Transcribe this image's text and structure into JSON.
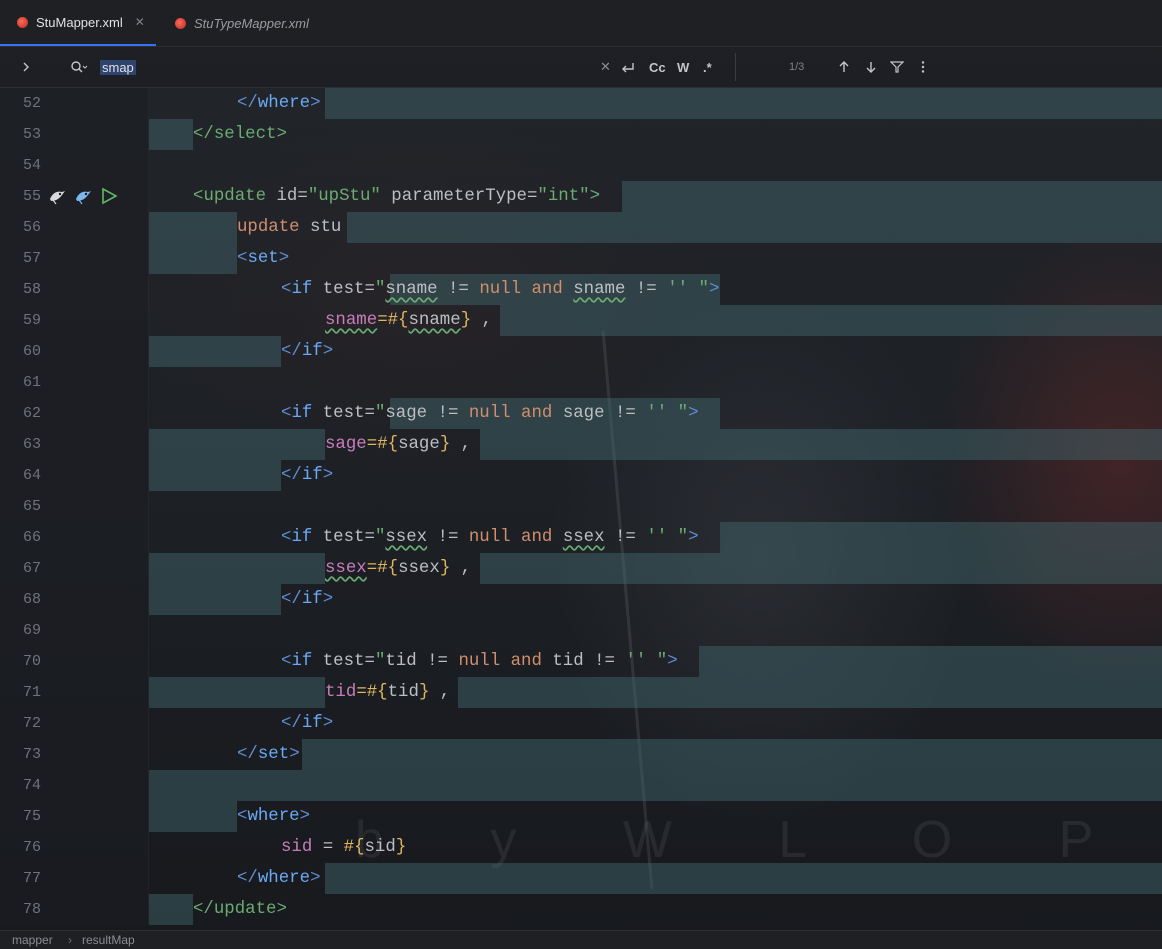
{
  "tabs": [
    {
      "label": "StuMapper.xml",
      "active": true,
      "close_icon": "close-icon"
    },
    {
      "label": "StuTypeMapper.xml",
      "active": false
    }
  ],
  "search": {
    "query": "smap",
    "options": [
      "Cc",
      "W",
      ".*"
    ],
    "match_count": "1/3"
  },
  "lines": [
    "52",
    "53",
    "54",
    "55",
    "56",
    "57",
    "58",
    "59",
    "60",
    "61",
    "62",
    "63",
    "64",
    "65",
    "66",
    "67",
    "68",
    "69",
    "70",
    "71",
    "72",
    "73",
    "74",
    "75",
    "76",
    "77",
    "78"
  ],
  "code": {
    "l52": {
      "open": "</",
      "tag": "where",
      "close": ">"
    },
    "l53": {
      "open": "</",
      "tag": "select",
      "close": ">"
    },
    "l55": {
      "open": "<",
      "tag": "update",
      "attr1": " id=",
      "val1": "\"upStu\"",
      "attr2": " parameterType=",
      "val2": "\"int\"",
      "close": ">"
    },
    "l56": {
      "kw": "update",
      "rest": " stu"
    },
    "l57": {
      "open": "<",
      "tag": "set",
      "close": ">"
    },
    "l58": {
      "open": "<",
      "tag": "if",
      "attr": " test=",
      "q": "\"",
      "v1": "sname",
      "op1": " != ",
      "nul": "null",
      "and": " and ",
      "v2": "sname",
      "op2": " != ",
      "e": "''",
      "q2": " \"",
      "close": ">"
    },
    "l59": {
      "prop": "sname",
      "eq": "=#{",
      "v": "sname",
      "rb": "}",
      "comma": " ,"
    },
    "l60": {
      "open": "</",
      "tag": "if",
      "close": ">"
    },
    "l62": {
      "open": "<",
      "tag": "if",
      "attr": " test=",
      "q": "\"",
      "v1": "sage",
      "op1": " != ",
      "nul": "null",
      "and": " and ",
      "v2": "sage",
      "op2": " != ",
      "e": "''",
      "q2": " \"",
      "close": ">"
    },
    "l63": {
      "prop": "sage",
      "eq": "=#{",
      "v": "sage",
      "rb": "}",
      "comma": " ,"
    },
    "l64": {
      "open": "</",
      "tag": "if",
      "close": ">"
    },
    "l66": {
      "open": "<",
      "tag": "if",
      "attr": " test=",
      "q": "\"",
      "v1": "ssex",
      "op1": " != ",
      "nul": "null",
      "and": " and ",
      "v2": "ssex",
      "op2": " != ",
      "e": "''",
      "q2": " \"",
      "close": ">"
    },
    "l67": {
      "prop": "ssex",
      "eq": "=#{",
      "v": "ssex",
      "rb": "}",
      "comma": " ,"
    },
    "l68": {
      "open": "</",
      "tag": "if",
      "close": ">"
    },
    "l70": {
      "open": "<",
      "tag": "if",
      "attr": " test=",
      "q": "\"",
      "v1": "tid",
      "op1": " != ",
      "nul": "null",
      "and": " and ",
      "v2": "tid",
      "op2": " != ",
      "e": "''",
      "q2": " \"",
      "close": ">"
    },
    "l71": {
      "prop": "tid",
      "eq": "=#{",
      "v": "tid",
      "rb": "}",
      "comma": " ,"
    },
    "l72": {
      "open": "</",
      "tag": "if",
      "close": ">"
    },
    "l73": {
      "open": "</",
      "tag": "set",
      "close": ">"
    },
    "l75": {
      "open": "<",
      "tag": "where",
      "close": ">"
    },
    "l76": {
      "col": "sid",
      "eq": " = ",
      "hash": "#",
      "lb": "{",
      "v": "sid",
      "rb": "}"
    },
    "l77": {
      "open": "</",
      "tag": "where",
      "close": ">"
    },
    "l78": {
      "open": "</",
      "tag": "update",
      "close": ">"
    }
  },
  "watermark": "b y   W L O P",
  "breadcrumb": [
    "mapper",
    "resultMap"
  ],
  "colors": {
    "accent": "#3574f0",
    "tag": "#5f8dd3",
    "string": "#6aab73",
    "keyword": "#cf8e6d",
    "highlight": "#426a72"
  },
  "icons": [
    "chevron-right-icon",
    "search-icon",
    "clear-icon",
    "wrap-icon",
    "arrow-up-icon",
    "arrow-down-icon",
    "filter-icon",
    "more-icon",
    "mybatis-bird-icon",
    "run-icon"
  ]
}
